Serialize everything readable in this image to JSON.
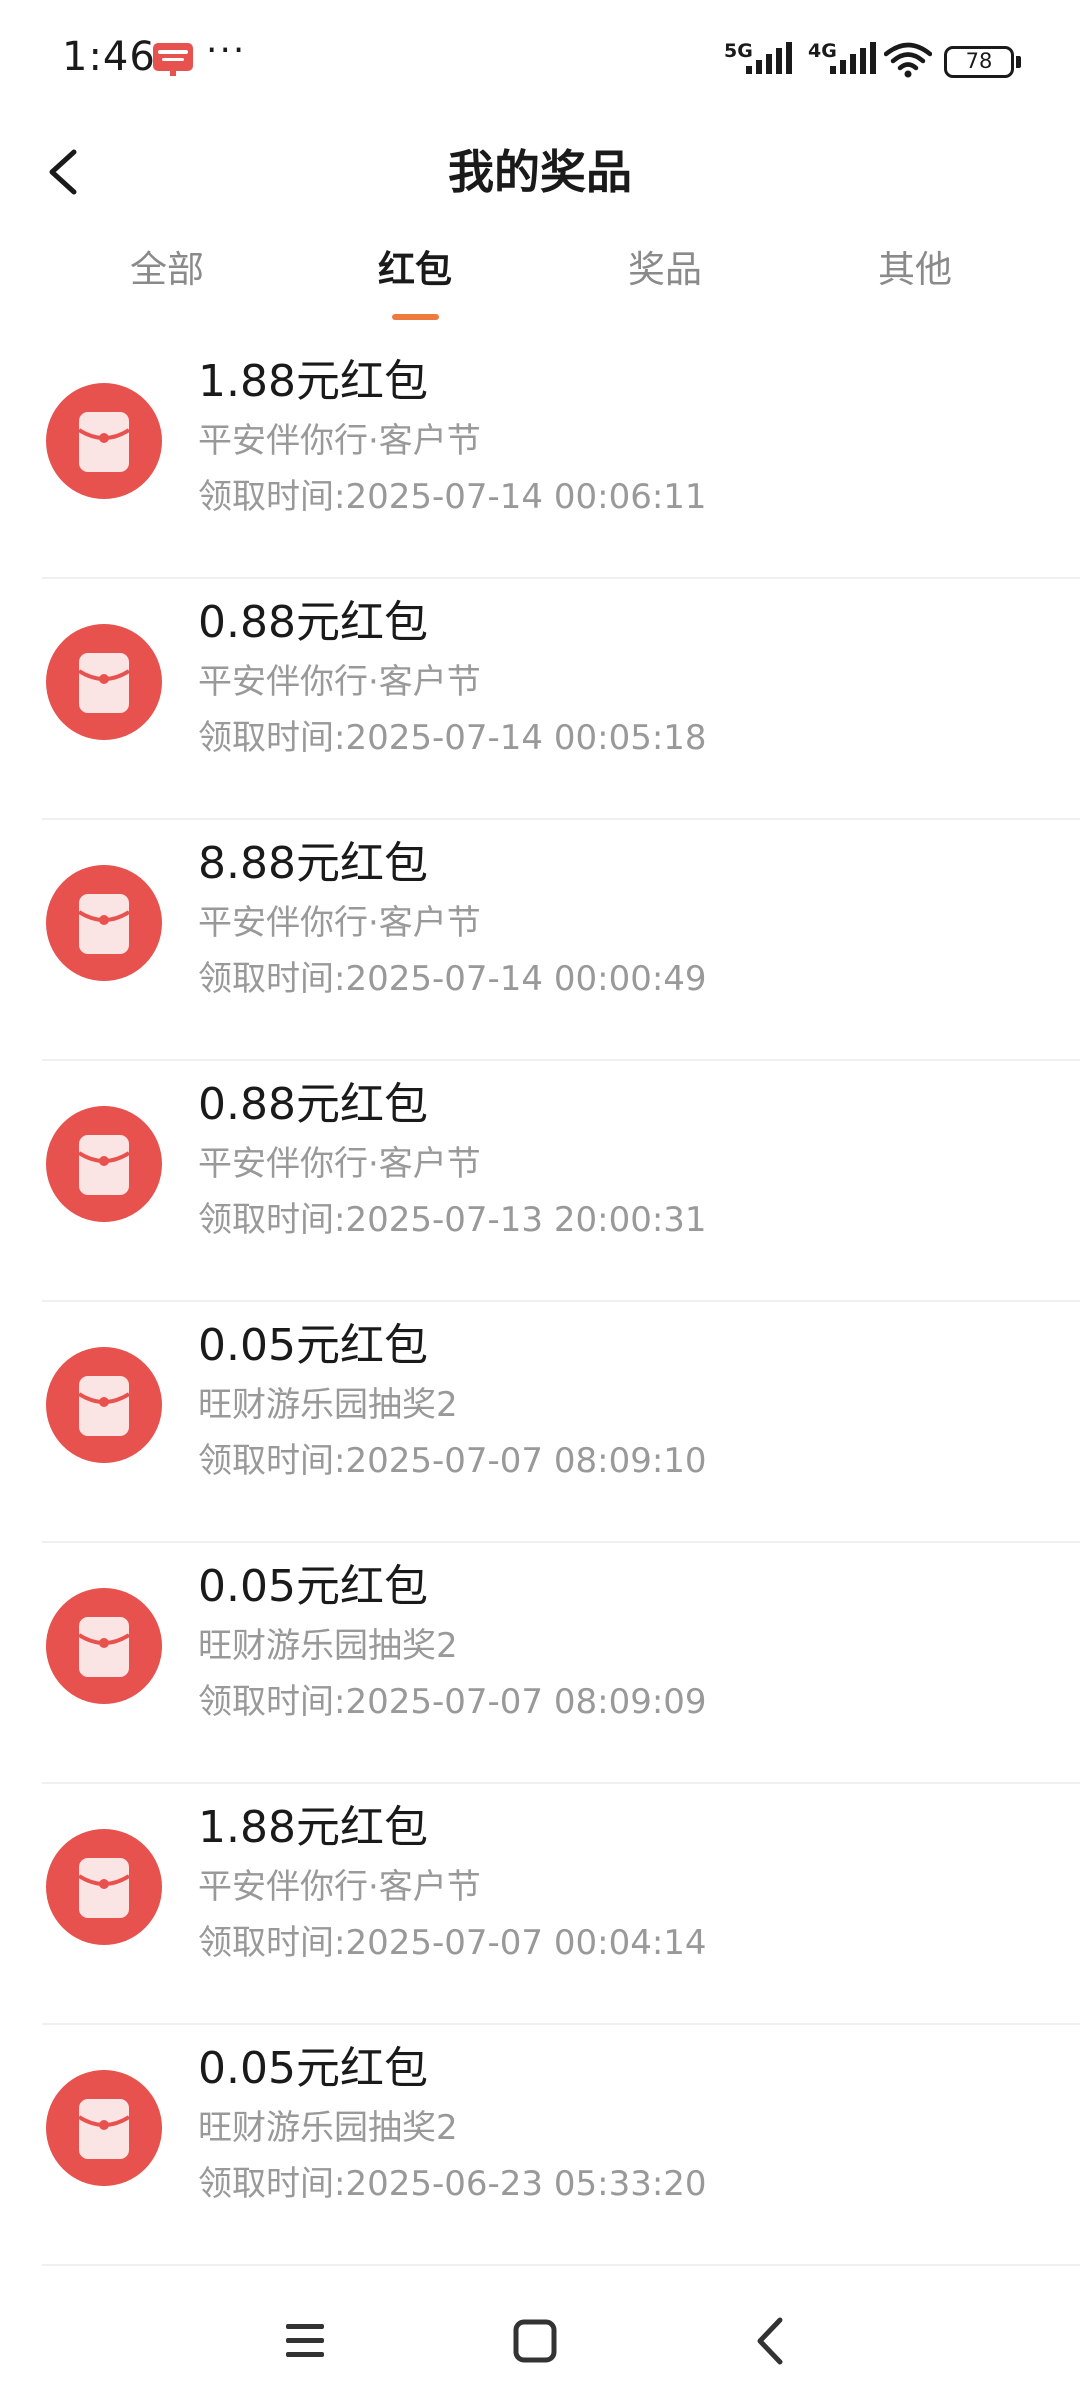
{
  "status_bar": {
    "time": "1:46",
    "dots": "···",
    "signal_5g": "5G",
    "signal_4g": "4G",
    "battery": "78"
  },
  "header": {
    "title": "我的奖品",
    "back_icon": "chevron-left-icon"
  },
  "tabs": [
    {
      "label": "全部",
      "active": false
    },
    {
      "label": "红包",
      "active": true
    },
    {
      "label": "奖品",
      "active": false
    },
    {
      "label": "其他",
      "active": false
    }
  ],
  "colors": {
    "accent": "#ef7a3e",
    "redpacket": "#e8524e"
  },
  "items": [
    {
      "title": "1.88元红包",
      "source": "平安伴你行·客户节",
      "time": "领取时间:2025-07-14 00:06:11",
      "icon": "red-packet-icon"
    },
    {
      "title": "0.88元红包",
      "source": "平安伴你行·客户节",
      "time": "领取时间:2025-07-14 00:05:18",
      "icon": "red-packet-icon"
    },
    {
      "title": "8.88元红包",
      "source": "平安伴你行·客户节",
      "time": "领取时间:2025-07-14 00:00:49",
      "icon": "red-packet-icon"
    },
    {
      "title": "0.88元红包",
      "source": "平安伴你行·客户节",
      "time": "领取时间:2025-07-13 20:00:31",
      "icon": "red-packet-icon"
    },
    {
      "title": "0.05元红包",
      "source": "旺财游乐园抽奖2",
      "time": "领取时间:2025-07-07 08:09:10",
      "icon": "red-packet-icon"
    },
    {
      "title": "0.05元红包",
      "source": "旺财游乐园抽奖2",
      "time": "领取时间:2025-07-07 08:09:09",
      "icon": "red-packet-icon"
    },
    {
      "title": "1.88元红包",
      "source": "平安伴你行·客户节",
      "time": "领取时间:2025-07-07 00:04:14",
      "icon": "red-packet-icon"
    },
    {
      "title": "0.05元红包",
      "source": "旺财游乐园抽奖2",
      "time": "领取时间:2025-06-23 05:33:20",
      "icon": "red-packet-icon"
    }
  ],
  "navbar": {
    "menu_icon": "menu-icon",
    "home_icon": "home-square-icon",
    "back_icon": "back-triangle-icon"
  }
}
